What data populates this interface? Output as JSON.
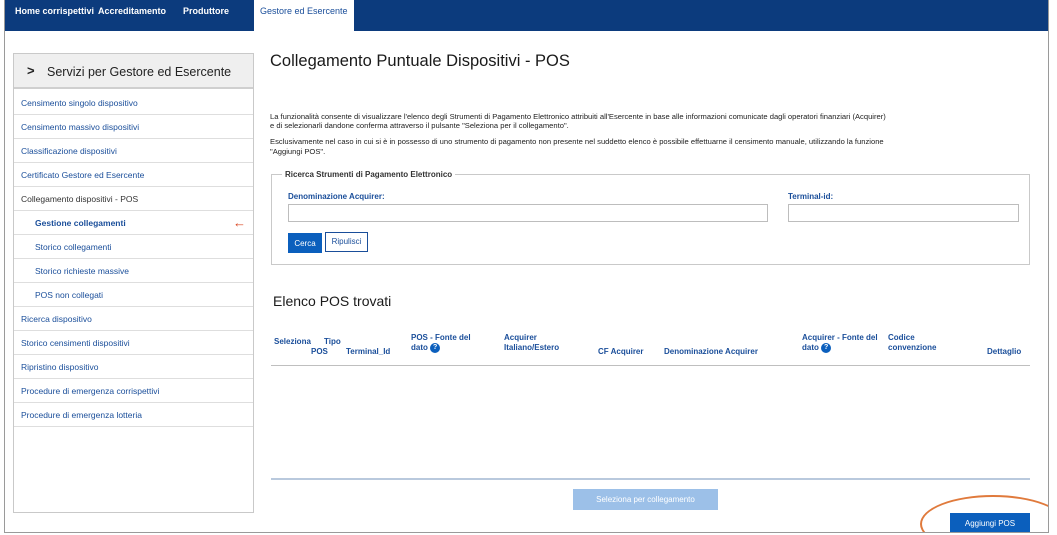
{
  "topnav": {
    "tabs": [
      {
        "label": "Home corrispettivi"
      },
      {
        "label": "Accreditamento"
      },
      {
        "label": "Produttore"
      },
      {
        "label": "Gestore ed Esercente",
        "active": true
      }
    ]
  },
  "sidebar": {
    "header": "Servizi per Gestore ed Esercente",
    "header_icon": "chevron-right-icon",
    "items": [
      {
        "label": "Censimento singolo dispositivo"
      },
      {
        "label": "Censimento massivo dispositivi"
      },
      {
        "label": "Classificazione dispositivi"
      },
      {
        "label": "Certificato Gestore ed Esercente"
      },
      {
        "label": "Collegamento dispositivi - POS"
      },
      {
        "label": "Gestione collegamenti",
        "active": true
      },
      {
        "label": "Storico collegamenti"
      },
      {
        "label": "Storico richieste massive"
      },
      {
        "label": "POS non collegati"
      },
      {
        "label": "Ricerca dispositivo"
      },
      {
        "label": "Storico censimenti dispositivi"
      },
      {
        "label": "Ripristino dispositivo"
      },
      {
        "label": "Procedure di emergenza corrispettivi"
      },
      {
        "label": "Procedure di emergenza lotteria"
      }
    ],
    "active_marker": "←"
  },
  "main": {
    "title": "Collegamento Puntuale Dispositivi - POS",
    "description": [
      "La funzionalità consente di visualizzare l'elenco degli Strumenti di Pagamento Elettronico attribuiti all'Esercente in base alle informazioni comunicate dagli operatori finanziari (Acquirer)",
      "e di selezionarli dandone conferma attraverso il pulsante \"Seleziona per il collegamento\".",
      "Esclusivamente nel caso in cui si è in possesso di uno strumento di pagamento non presente nel suddetto elenco è possibile effettuarne il censimento manuale, utilizzando la funzione",
      "\"Aggiungi POS\"."
    ],
    "search": {
      "legend": "Ricerca Strumenti di Pagamento Elettronico",
      "acquirer_label": "Denominazione Acquirer:",
      "acquirer_value": "",
      "terminal_label": "Terminal-id:",
      "terminal_value": "",
      "search_button": "Cerca",
      "reset_button": "Ripulisci"
    },
    "results": {
      "title": "Elenco POS trovati",
      "columns": [
        {
          "line1": "",
          "line2": "Seleziona"
        },
        {
          "line1": "Tipo",
          "line2": "POS"
        },
        {
          "line1": "",
          "line2": "Terminal_Id"
        },
        {
          "line1": "POS - Fonte del",
          "line2": "dato",
          "help": true
        },
        {
          "line1": "Acquirer",
          "line2": "Italiano/Estero"
        },
        {
          "line1": "",
          "line2": "CF Acquirer"
        },
        {
          "line1": "",
          "line2": "Denominazione Acquirer"
        },
        {
          "line1": "Acquirer - Fonte del",
          "line2": "dato",
          "help": true
        },
        {
          "line1": "Codice",
          "line2": "convenzione"
        },
        {
          "line1": "",
          "line2": "Dettaglio"
        }
      ],
      "help_icon_glyph": "?",
      "rows": []
    },
    "select_button": "Seleziona per collegamento",
    "add_button": "Aggiungi POS"
  }
}
